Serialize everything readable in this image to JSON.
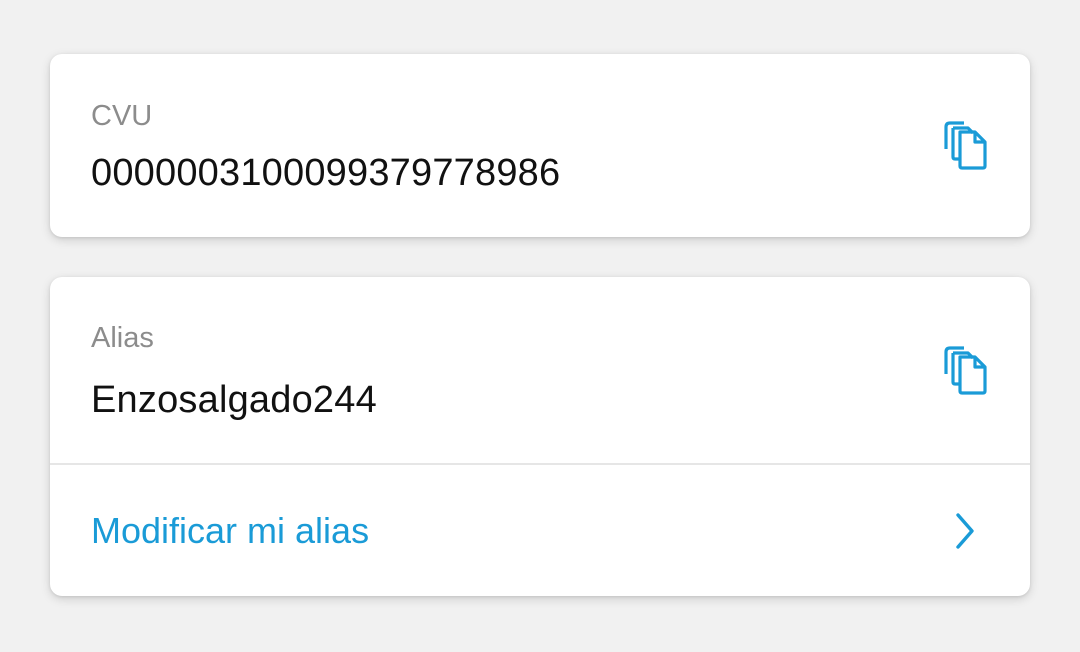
{
  "colors": {
    "background": "#f1f1f1",
    "card": "#ffffff",
    "label": "#8c8c8c",
    "value": "#111111",
    "accent": "#1a9bd7",
    "divider": "#e6e6e6"
  },
  "cvu": {
    "label": "CVU",
    "value": "0000003100099379778986",
    "copy_icon": "copy-icon"
  },
  "alias": {
    "label": "Alias",
    "value": "Enzosalgado244",
    "copy_icon": "copy-icon",
    "modify_label": "Modificar mi alias",
    "modify_icon": "chevron-right-icon"
  }
}
